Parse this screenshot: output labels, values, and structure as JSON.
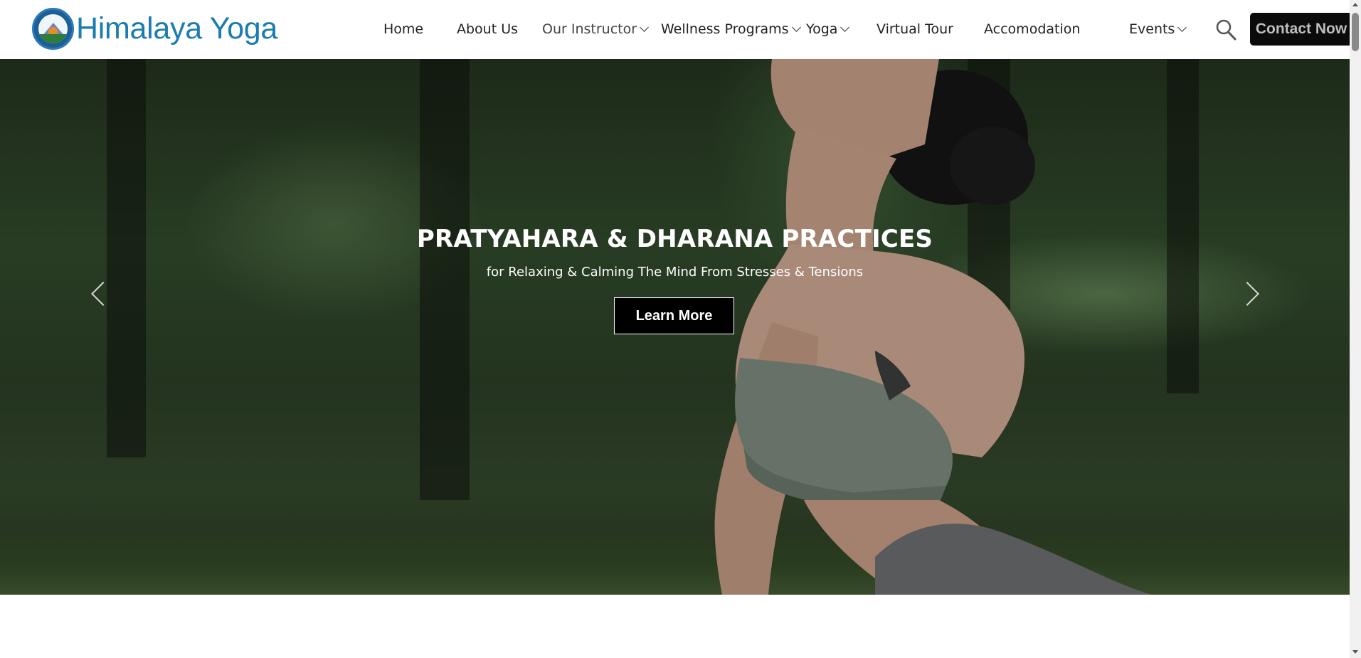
{
  "brand": {
    "name": "Himalaya Yoga"
  },
  "nav": {
    "items": [
      {
        "label": "Home",
        "dropdown": false
      },
      {
        "label": "About Us",
        "dropdown": false
      },
      {
        "label": "Our Instructor",
        "dropdown": true
      },
      {
        "label": "Wellness Programs",
        "dropdown": true
      },
      {
        "label": "Yoga",
        "dropdown": true
      },
      {
        "label": "Virtual Tour",
        "dropdown": false
      },
      {
        "label": "Accomodation",
        "dropdown": false
      },
      {
        "label": "Events",
        "dropdown": true
      }
    ],
    "search_icon": "search-icon",
    "contact_label": "Contact Now"
  },
  "hero": {
    "title": "PRATYAHARA & DHARANA PRACTICES",
    "subtitle": "for Relaxing & Calming The Mind From Stresses & Tensions",
    "cta_label": "Learn More",
    "prev_icon": "chevron-left-icon",
    "next_icon": "chevron-right-icon"
  },
  "colors": {
    "brand_text": "#1a7cb0",
    "button_bg": "#0b0b0b",
    "hero_text": "#ffffff"
  }
}
